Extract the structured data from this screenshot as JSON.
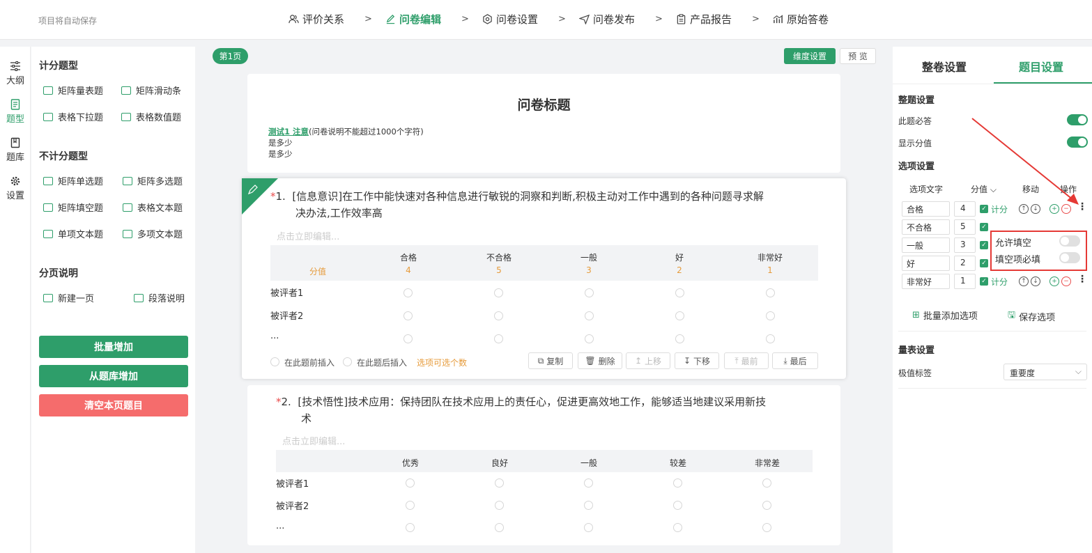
{
  "header": {
    "autosave": "项目将自动保存",
    "steps": [
      {
        "label": "评价关系",
        "icon": "people-icon"
      },
      {
        "label": "问卷编辑",
        "icon": "edit-icon"
      },
      {
        "label": "问卷设置",
        "icon": "settings-icon"
      },
      {
        "label": "问卷发布",
        "icon": "send-icon"
      },
      {
        "label": "产品报告",
        "icon": "clipboard-icon"
      },
      {
        "label": "原始答卷",
        "icon": "chart-icon"
      }
    ],
    "separator": ">"
  },
  "rail": [
    {
      "label": "大纲",
      "icon": "sliders-icon"
    },
    {
      "label": "题型",
      "icon": "document-icon"
    },
    {
      "label": "题库",
      "icon": "book-icon"
    },
    {
      "label": "设置",
      "icon": "gear-icon"
    }
  ],
  "left": {
    "scored_title": "计分题型",
    "scored": [
      "矩阵量表题",
      "矩阵滑动条",
      "表格下拉题",
      "表格数值题"
    ],
    "unscored_title": "不计分题型",
    "unscored": [
      "矩阵单选题",
      "矩阵多选题",
      "矩阵填空题",
      "表格文本题",
      "单项文本题",
      "多项文本题"
    ],
    "paging_title": "分页说明",
    "paging": [
      "新建一页",
      "段落说明"
    ],
    "btn_batch": "批量增加",
    "btn_bank": "从题库增加",
    "btn_clear": "清空本页题目"
  },
  "main": {
    "page_badge": "第1页",
    "dim_btn": "维度设置",
    "preview_btn": "预 览",
    "title": "问卷标题",
    "desc_link": "测试1  注意",
    "desc_text": "(问卷说明不能超过1000个字符)",
    "desc_line2": "是多少",
    "desc_line3": "是多少",
    "q1": {
      "num": "1.",
      "text1": "[信息意识]在工作中能快速对各种信息进行敏锐的洞察和判断,积极主动对工作中遇到的各种问题寻求解",
      "text2": "决办法,工作效率高",
      "placeholder": "点击立即编辑...",
      "cols": [
        "合格",
        "不合格",
        "一般",
        "好",
        "非常好"
      ],
      "score_label": "分值",
      "scores": [
        "4",
        "5",
        "3",
        "2",
        "1"
      ],
      "rows": [
        "被评者1",
        "被评者2",
        "..."
      ],
      "insert_before": "在此题前插入",
      "insert_after": "在此题后插入",
      "options_hint": "选项可选个数",
      "actions": [
        "复制",
        "删除",
        "上移",
        "下移",
        "最前",
        "最后"
      ]
    },
    "q2": {
      "num": "2.",
      "text1": "[技术悟性]技术应用：保持团队在技术应用上的责任心，促进更高效地工作，能够适当地建议采用新技",
      "text2": "术",
      "placeholder": "点击立即编辑...",
      "cols": [
        "优秀",
        "良好",
        "一般",
        "较差",
        "非常差"
      ],
      "rows": [
        "被评者1",
        "被评者2",
        "..."
      ]
    }
  },
  "right": {
    "tab_whole": "整卷设置",
    "tab_item": "题目设置",
    "whole_title": "整题设置",
    "required_label": "此题必答",
    "show_score_label": "显示分值",
    "options_title": "选项设置",
    "opt_headers": [
      "选项文字",
      "分值",
      "移动",
      "操作"
    ],
    "options": [
      {
        "text": "合格",
        "score": "4"
      },
      {
        "text": "不合格",
        "score": "5"
      },
      {
        "text": "一般",
        "score": "3"
      },
      {
        "text": "好",
        "score": "2"
      },
      {
        "text": "非常好",
        "score": "1"
      }
    ],
    "score_chk": "计分",
    "popup_allow": "允许填空",
    "popup_required": "填空项必填",
    "batch_add": "批量添加选项",
    "save_opts": "保存选项",
    "scale_title": "量表设置",
    "pole_label": "极值标签",
    "pole_value": "重要度"
  },
  "colors": {
    "accent": "#2e9e6a",
    "danger": "#f56c6c",
    "score": "#e69b3b"
  }
}
